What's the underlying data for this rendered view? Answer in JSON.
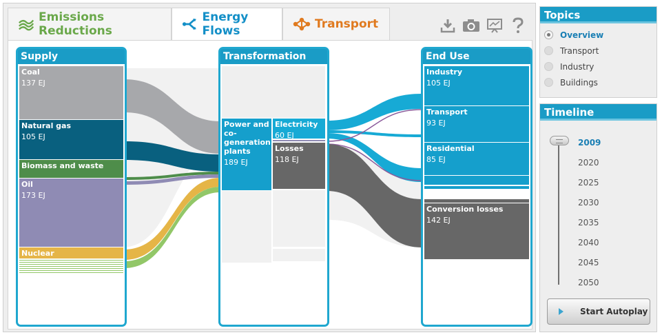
{
  "tabs": [
    {
      "label": "Emissions Reductions",
      "icon": "emissions-lines-icon",
      "color": "#6aa84a",
      "active": false
    },
    {
      "label": "Energy Flows",
      "icon": "energy-flows-icon",
      "color": "#138fc7",
      "active": true
    },
    {
      "label": "Transport",
      "icon": "transport-network-icon",
      "color": "#e07a1f",
      "active": false
    }
  ],
  "toolbar": [
    "download-icon",
    "camera-icon",
    "presentation-icon",
    "help-icon"
  ],
  "columns": {
    "supply": "Supply",
    "transformation": "Transformation",
    "end_use": "End Use"
  },
  "supply": [
    {
      "name": "Coal",
      "value": "137 EJ",
      "color": "#a7a8ab"
    },
    {
      "name": "Natural gas",
      "value": "105 EJ",
      "color": "#09607f"
    },
    {
      "name": "Biomass and waste",
      "value": "",
      "color": "#4e8d4a"
    },
    {
      "name": "Oil",
      "value": "173 EJ",
      "color": "#8f8bb4"
    },
    {
      "name": "Nuclear",
      "value": "",
      "color": "#e5b547"
    }
  ],
  "transformation": [
    {
      "name": "Power and co-generation plants",
      "value": "189 EJ",
      "color": "#159fcc"
    },
    {
      "name": "Electricity",
      "value": "60 EJ",
      "color": "#17aad5"
    },
    {
      "name": "Losses",
      "value": "118 EJ",
      "color": "#676767"
    }
  ],
  "end_use": [
    {
      "name": "Industry",
      "value": "105 EJ",
      "color": "#159fcc"
    },
    {
      "name": "Transport",
      "value": "93 EJ",
      "color": "#159fcc"
    },
    {
      "name": "Residential",
      "value": "85 EJ",
      "color": "#159fcc"
    },
    {
      "name": "Conversion losses",
      "value": "142 EJ",
      "color": "#676767"
    }
  ],
  "topics": {
    "title": "Topics",
    "items": [
      {
        "label": "Overview",
        "selected": true
      },
      {
        "label": "Transport",
        "selected": false
      },
      {
        "label": "Industry",
        "selected": false
      },
      {
        "label": "Buildings",
        "selected": false
      }
    ]
  },
  "timeline": {
    "title": "Timeline",
    "years": [
      "2009",
      "2020",
      "2025",
      "2030",
      "2035",
      "2040",
      "2045",
      "2050"
    ],
    "current": "2009",
    "autoplay_label": "Start Autoplay"
  }
}
